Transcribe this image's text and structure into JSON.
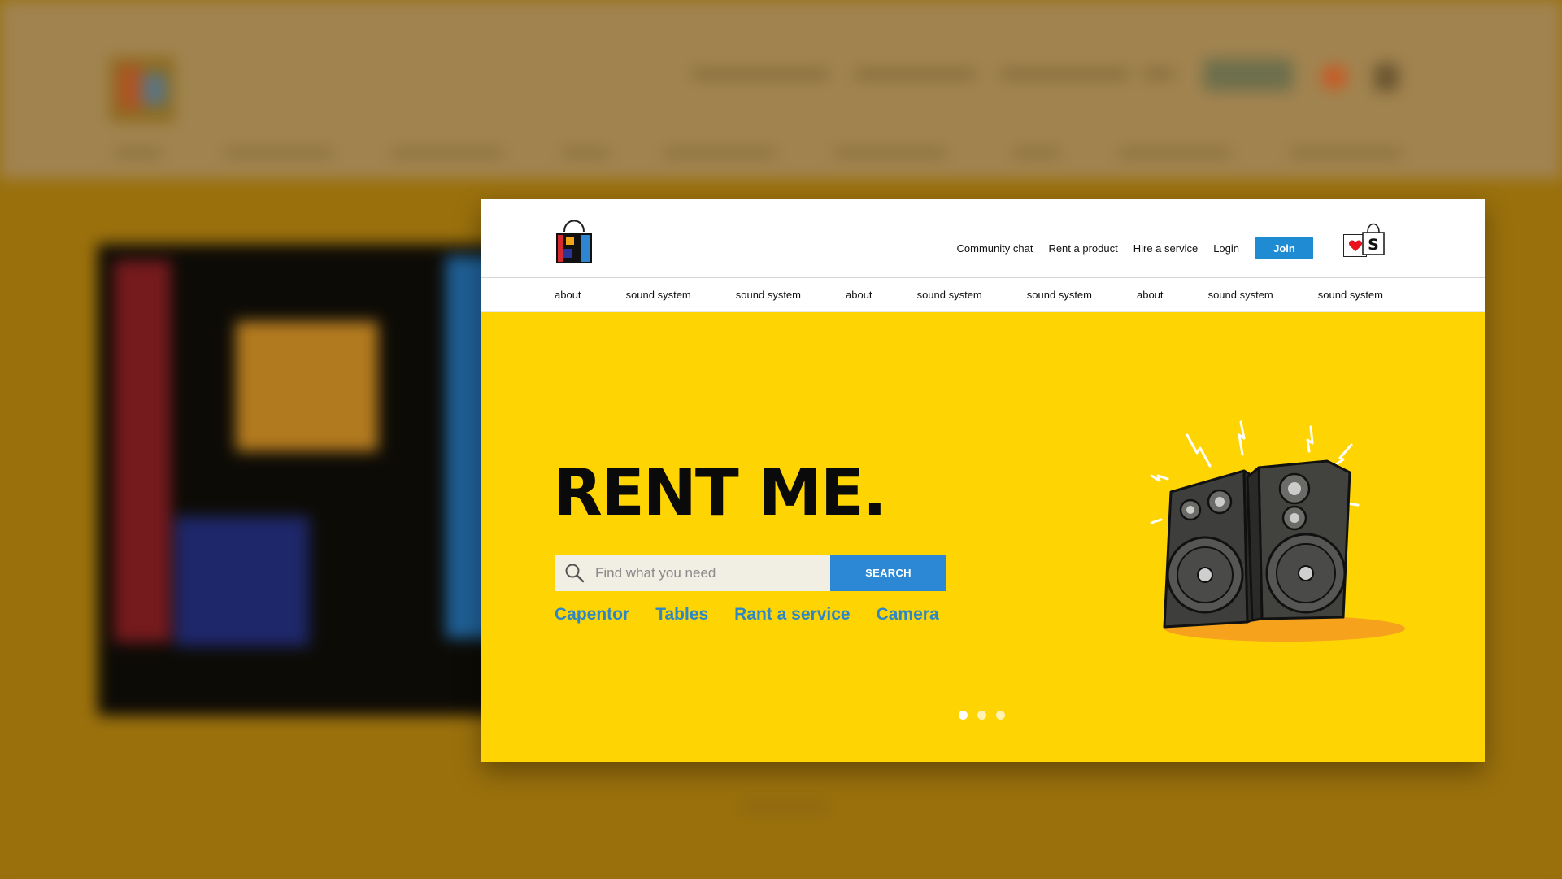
{
  "header": {
    "top_links": [
      "Community chat",
      "Rent a product",
      "Hire a service",
      "Login"
    ],
    "join_label": "Join",
    "cart_letter": "S"
  },
  "nav": {
    "items": [
      "about",
      "sound system",
      "sound system",
      "about",
      "sound system",
      "sound system",
      "about",
      "sound system",
      "sound system"
    ]
  },
  "hero": {
    "title": "RENT ME.",
    "search_placeholder": "Find what you need",
    "search_button": "SEARCH",
    "quick_links": [
      "Capentor",
      "Tables",
      "Rant a service",
      "Camera"
    ],
    "slides_total": 3,
    "active_slide": 1
  },
  "icons": {
    "logo": "shopping-bag-logo",
    "favorites": "heart-icon",
    "cart": "shopping-bag-icon",
    "search": "magnifier-icon",
    "illustration": "speakers-illustration"
  },
  "colors": {
    "hero_bg": "#ffd403",
    "accent_blue": "#2c88d4",
    "link_blue": "#2d87c6",
    "heart_red": "#e8131e"
  }
}
